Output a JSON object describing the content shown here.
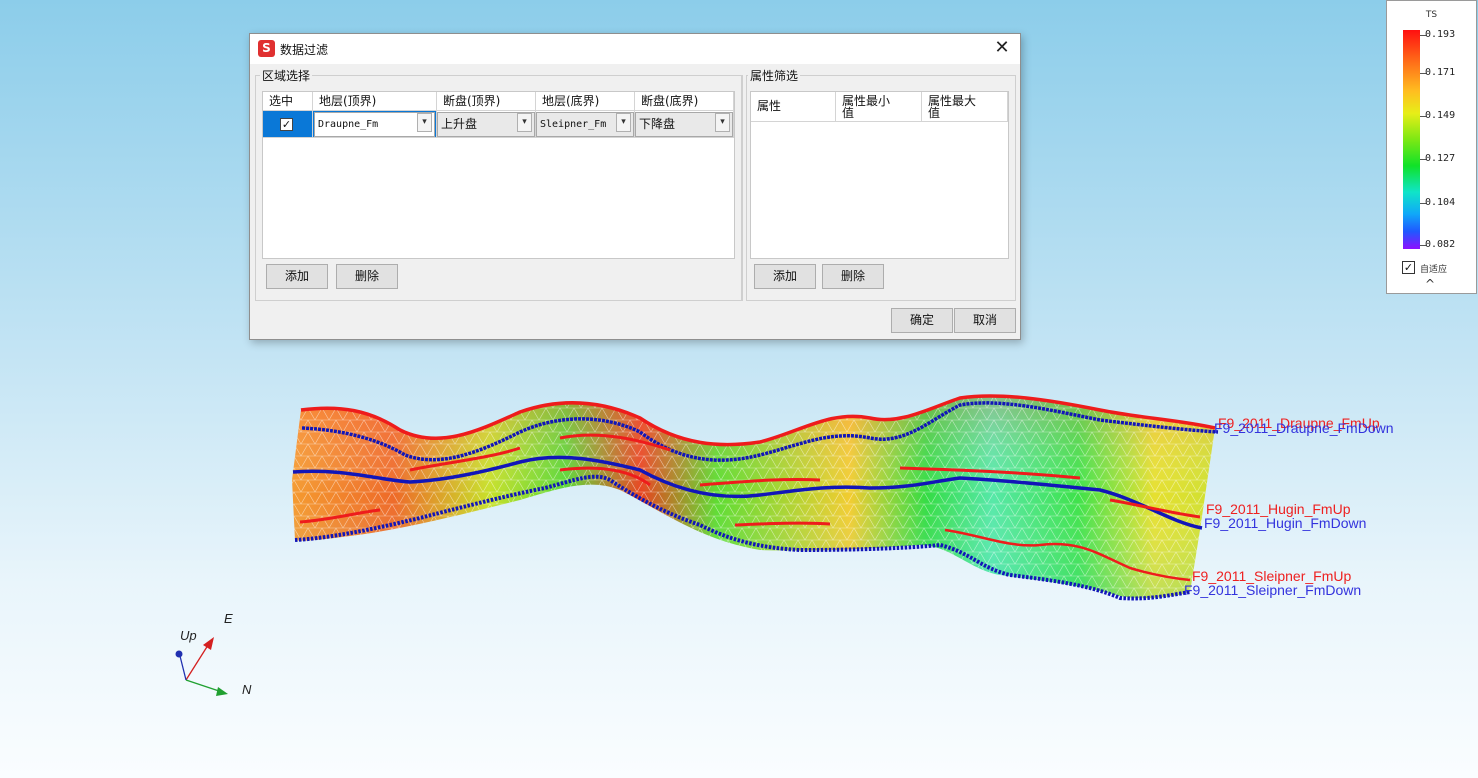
{
  "dialog": {
    "title": "数据过滤",
    "app_icon_glyph": "S",
    "close_glyph": "✕",
    "region": {
      "label": "区域选择",
      "columns": [
        "选中",
        "地层(顶界)",
        "断盘(顶界)",
        "地层(底界)",
        "断盘(底界)"
      ],
      "rows": [
        {
          "checked": "✓",
          "top_layer": "Draupne_Fm",
          "top_fault_block": "上升盘",
          "bottom_layer": "Sleipner_Fm",
          "bottom_fault_block": "下降盘"
        }
      ],
      "add_button": "添加",
      "delete_button": "删除"
    },
    "attr": {
      "label": "属性筛选",
      "columns": [
        "属性",
        "属性最小值",
        "属性最大值"
      ],
      "add_button": "添加",
      "delete_button": "删除"
    },
    "ok_button": "确定",
    "cancel_button": "取消"
  },
  "legend": {
    "title": "TS",
    "ticks": [
      "0.193",
      "0.171",
      "0.149",
      "0.127",
      "0.104",
      "0.082"
    ],
    "adaptive_checked": "✓",
    "adaptive_label": "自适应",
    "collapse_glyph": "^"
  },
  "scene": {
    "horizon_labels": [
      {
        "text": "F9_2011_Draupne_FmUp",
        "color": "#ee2020"
      },
      {
        "text": "F9_2011_Draupne_FmDown",
        "color": "#3333dd"
      },
      {
        "text": "F9_2011_Hugin_FmUp",
        "color": "#ee2020"
      },
      {
        "text": "F9_2011_Hugin_FmDown",
        "color": "#3333dd"
      },
      {
        "text": "F9_2011_Sleipner_FmUp",
        "color": "#ee2020"
      },
      {
        "text": "F9_2011_Sleipner_FmDown",
        "color": "#3333dd"
      }
    ],
    "axes": {
      "up": "Up",
      "east": "E",
      "north": "N"
    }
  },
  "colors": {
    "up_horizon": "#ee1c1c",
    "down_horizon": "#1216b8",
    "selection": "#0a78d7",
    "background_top": "#8ccdea"
  }
}
